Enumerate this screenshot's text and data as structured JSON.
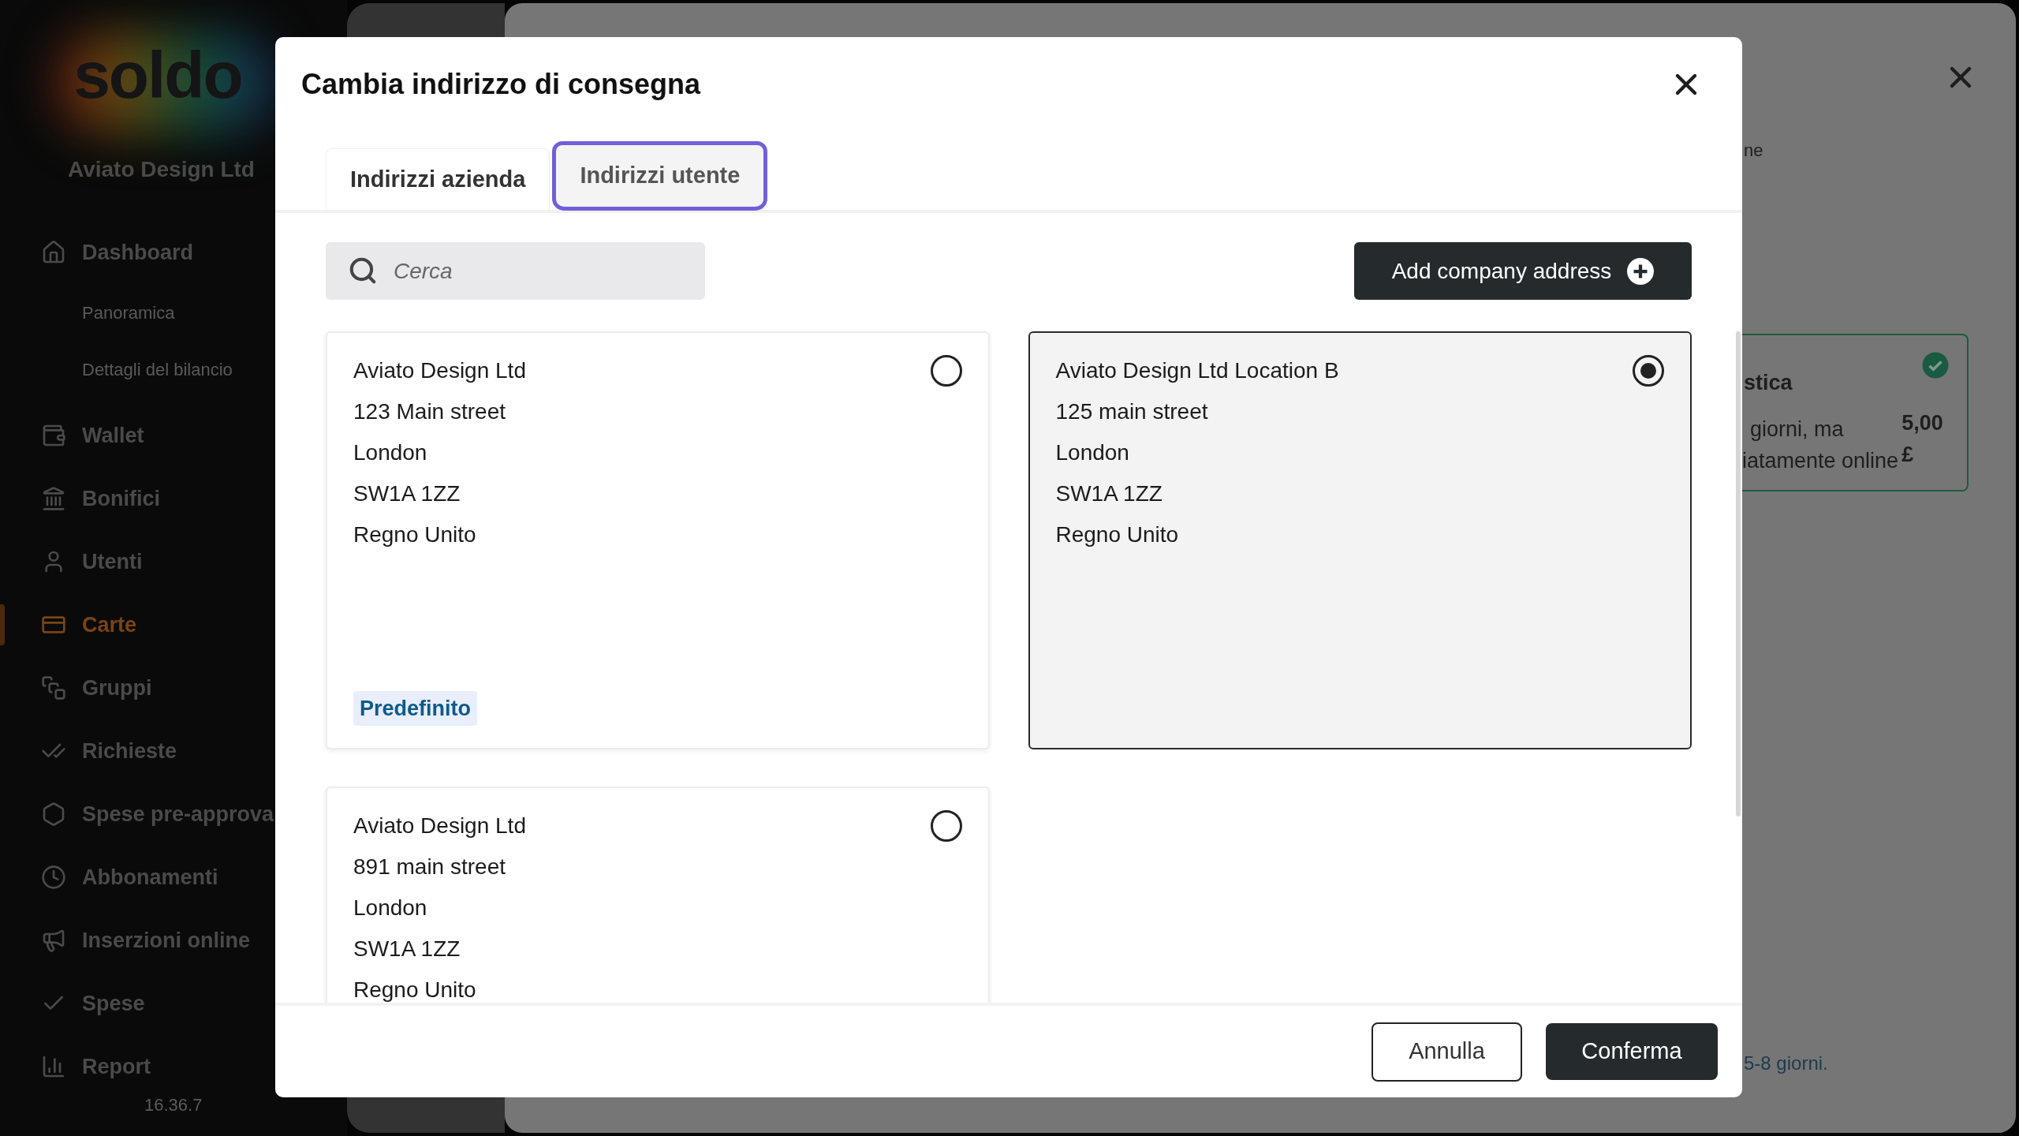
{
  "sidebar": {
    "logo": "soldo",
    "company": "Aviato Design Ltd",
    "items": [
      {
        "kind": "main",
        "label": "Dashboard",
        "selected": false
      },
      {
        "kind": "sub",
        "label": "Panoramica",
        "selected": false
      },
      {
        "kind": "sub",
        "label": "Dettagli del bilancio",
        "selected": false
      },
      {
        "kind": "main",
        "label": "Wallet",
        "selected": false
      },
      {
        "kind": "main",
        "label": "Bonifici",
        "selected": false
      },
      {
        "kind": "main",
        "label": "Utenti",
        "selected": false
      },
      {
        "kind": "main",
        "label": "Carte",
        "selected": true
      },
      {
        "kind": "main",
        "label": "Gruppi",
        "selected": false
      },
      {
        "kind": "main",
        "label": "Richieste",
        "selected": false
      },
      {
        "kind": "main",
        "label": "Spese pre-approva",
        "selected": false
      },
      {
        "kind": "main",
        "label": "Abbonamenti",
        "selected": false
      },
      {
        "kind": "main",
        "label": "Inserzioni online",
        "selected": false
      },
      {
        "kind": "main",
        "label": "Spese",
        "selected": false
      },
      {
        "kind": "main",
        "label": "Report",
        "selected": false
      }
    ],
    "version": "16.36.7"
  },
  "background_panel": {
    "heading_fragment": "ne",
    "option_card": {
      "title_fragment": "stica",
      "line_1": "giorni, ma",
      "line_2": "iatamente online",
      "price": "5,00",
      "currency": "£",
      "checked": true
    },
    "note_fragment": "5-8 giorni."
  },
  "dialog": {
    "title": "Cambia indirizzo di consegna",
    "tabs": [
      {
        "label": "Indirizzi azienda",
        "selected": true,
        "focused": false
      },
      {
        "label": "Indirizzi utente",
        "selected": false,
        "focused": true
      }
    ],
    "search": {
      "placeholder": "Cerca"
    },
    "add_button": "Add company address",
    "addresses": [
      {
        "lines": [
          "Aviato Design Ltd",
          "123 Main street",
          "London",
          "SW1A 1ZZ",
          "Regno Unito"
        ],
        "badge": "Predefinito",
        "selected": false
      },
      {
        "lines": [
          "Aviato Design Ltd Location B",
          "125 main street",
          "London",
          "SW1A 1ZZ",
          "Regno Unito"
        ],
        "selected": true
      },
      {
        "lines": [
          "Aviato Design Ltd",
          "891 main street",
          "London",
          "SW1A 1ZZ",
          "Regno Unito"
        ],
        "selected": false
      }
    ],
    "buttons": {
      "cancel": "Annulla",
      "confirm": "Conferma"
    }
  }
}
